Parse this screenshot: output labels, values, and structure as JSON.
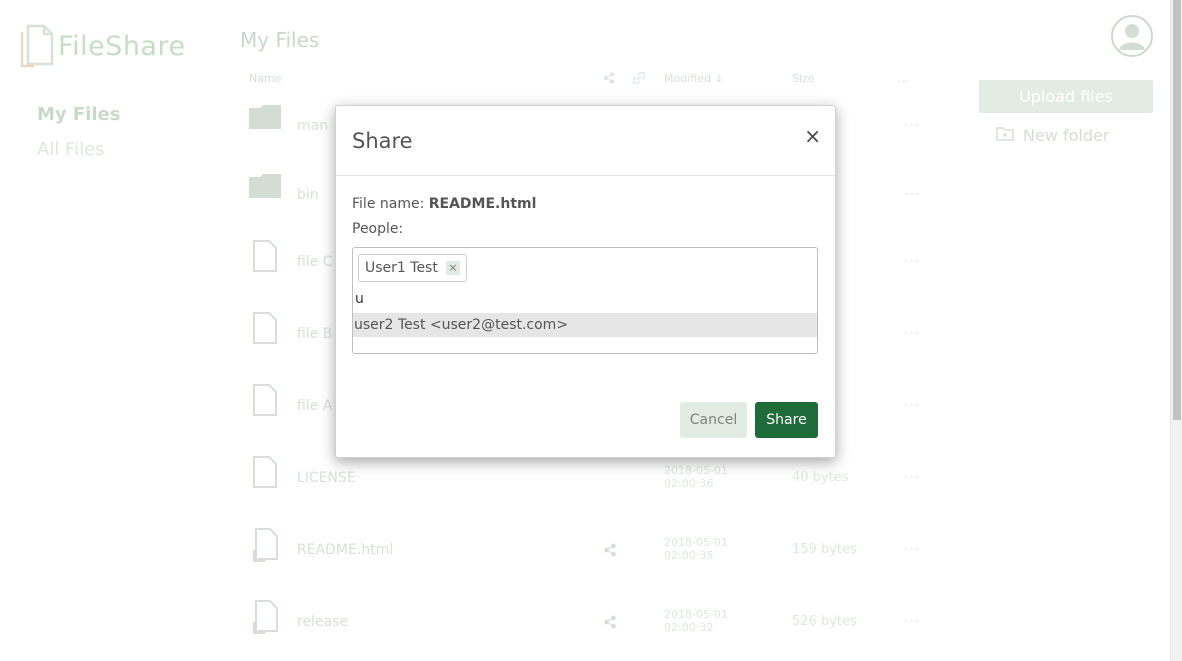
{
  "app": {
    "name": "FileShare"
  },
  "nav": {
    "items": [
      {
        "label": "My Files"
      },
      {
        "label": "All Files"
      }
    ]
  },
  "page": {
    "title": "My Files"
  },
  "table": {
    "headers": {
      "name": "Name",
      "modified": "Modified ↓",
      "size": "Size",
      "more": "..."
    },
    "rows": [
      {
        "type": "folder",
        "name": "man",
        "modified": "",
        "size": "",
        "shared": false
      },
      {
        "type": "folder",
        "name": "bin",
        "modified": "",
        "size": "",
        "shared": false
      },
      {
        "type": "file",
        "name": "file C",
        "modified": "",
        "size": "",
        "shared": false
      },
      {
        "type": "file",
        "name": "file B",
        "modified": "",
        "size": "",
        "shared": false
      },
      {
        "type": "file",
        "name": "file A",
        "modified": "",
        "size": "",
        "shared": false
      },
      {
        "type": "file",
        "name": "LICENSE",
        "modified_date": "2018-05-01",
        "modified_time": "02:00:36",
        "size": "40 bytes",
        "shared": false
      },
      {
        "type": "shared-file",
        "name": "README.html",
        "modified_date": "2018-05-01",
        "modified_time": "02:00:35",
        "size": "159 bytes",
        "shared": true
      },
      {
        "type": "shared-file",
        "name": "release",
        "modified_date": "2018-05-01",
        "modified_time": "02:00:32",
        "size": "526 bytes",
        "shared": true
      }
    ]
  },
  "actions": {
    "upload_label": "Upload files",
    "new_folder_label": "New folder"
  },
  "modal": {
    "title": "Share",
    "close": "×",
    "file_name_label": "File name:",
    "file_name_value": "README.html",
    "people_label": "People:",
    "tags": [
      {
        "label": "User1 Test",
        "remove": "×"
      }
    ],
    "input_value": "u",
    "suggestion": "user2 Test <user2@test.com>",
    "cancel_label": "Cancel",
    "share_label": "Share"
  },
  "colors": {
    "accent": "#1f6b3a",
    "accent_light": "#e3ece3"
  }
}
